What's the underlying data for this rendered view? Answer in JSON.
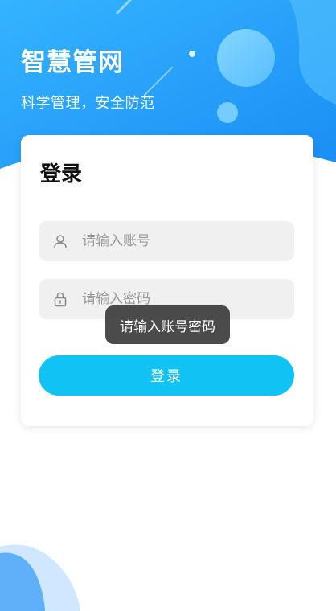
{
  "header": {
    "title": "智慧管网",
    "slogan": "科学管理，安全防范"
  },
  "login": {
    "title": "登录",
    "username": {
      "placeholder": "请输入账号",
      "value": "",
      "icon": "user-icon"
    },
    "password": {
      "placeholder": "请输入密码",
      "value": "",
      "icon": "lock-icon"
    },
    "submit_label": "登录"
  },
  "toast": {
    "message": "请输入账号密码"
  },
  "colors": {
    "accent": "#11c3f5",
    "hero_start": "#2aa8ff",
    "hero_end": "#1e8cf5"
  }
}
